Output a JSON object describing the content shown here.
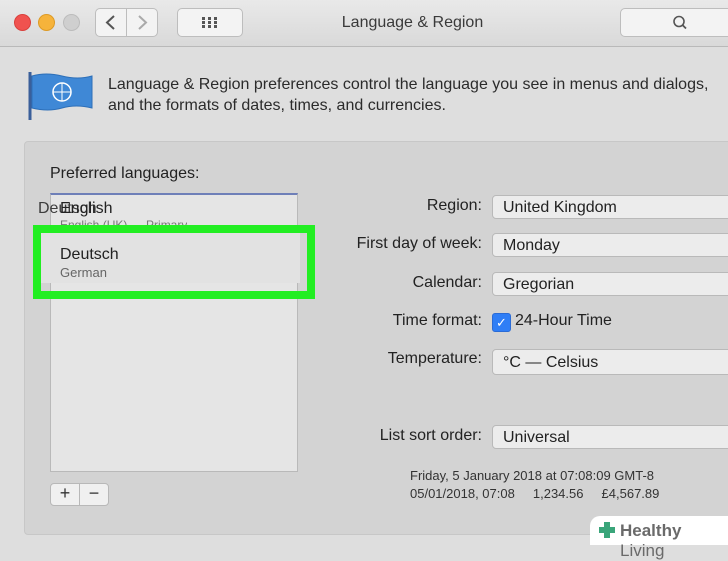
{
  "window": {
    "title": "Language & Region"
  },
  "header": {
    "description_line1": "Language & Region preferences control the language you see in menus and dialogs,",
    "description_line2": "and the formats of dates, times, and currencies."
  },
  "languages": {
    "label": "Preferred languages:",
    "items": [
      {
        "name": "English",
        "subtitle": "English (UK) — Primary"
      },
      {
        "name": "Deutsch",
        "subtitle": "German"
      }
    ],
    "add_label": "+",
    "remove_label": "−"
  },
  "settings": {
    "region": {
      "label": "Region:",
      "value": "United Kingdom"
    },
    "first_day": {
      "label": "First day of week:",
      "value": "Monday"
    },
    "calendar": {
      "label": "Calendar:",
      "value": "Gregorian"
    },
    "time_format": {
      "label": "Time format:",
      "checkbox_label": "24-Hour Time",
      "checked": true
    },
    "temperature": {
      "label": "Temperature:",
      "value": "°C — Celsius"
    },
    "sort_order": {
      "label": "List sort order:",
      "value": "Universal"
    }
  },
  "sample": {
    "line1": "Friday, 5 January 2018 at 07:08:09 GMT-8",
    "line2": "05/01/2018, 07:08     1,234.56     £4,567.89"
  },
  "watermark": {
    "bold": "Healthy",
    "regular": " Living"
  },
  "colors": {
    "highlight": "#22ee22",
    "checkbox": "#2f7ef6",
    "close": "#f0524f",
    "minimize": "#f6b33b"
  }
}
